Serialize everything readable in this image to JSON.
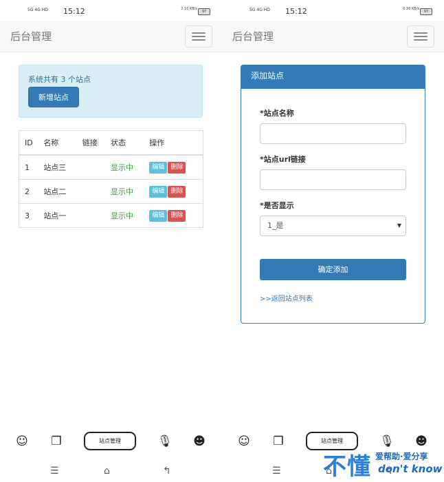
{
  "status_bar": {
    "signal_text": "5G 4G HD",
    "time": "15:12",
    "left_speed": "2.10 KB/s",
    "right_speed": "0.30 KB/s",
    "battery": "97"
  },
  "nav": {
    "brand": "后台管理"
  },
  "list_page": {
    "summary": "系统共有 3 个站点",
    "new_button": "新增站点",
    "table": {
      "headers": [
        "ID",
        "名称",
        "链接",
        "状态",
        "操作"
      ],
      "rows": [
        {
          "id": "1",
          "name": "站点三",
          "link": "",
          "status": "显示中"
        },
        {
          "id": "2",
          "name": "站点二",
          "link": "",
          "status": "显示中"
        },
        {
          "id": "3",
          "name": "站点一",
          "link": "",
          "status": "显示中"
        }
      ],
      "edit_label": "编辑",
      "delete_label": "删除"
    }
  },
  "add_page": {
    "heading": "添加站点",
    "name_label": "*站点名称",
    "name_value": "",
    "url_label": "*站点url链接",
    "url_value": "",
    "show_label": "*是否显示",
    "show_selected": "1_是",
    "submit_label": "确定添加",
    "back_link": ">>返回站点列表"
  },
  "dock": {
    "pill_label": "站点管理"
  },
  "watermark": {
    "main": "不懂",
    "sub1": "爱帮助·爱分享",
    "sub2": "don't know"
  },
  "colors": {
    "primary": "#337ab7",
    "info_bg": "#d9edf7",
    "info_text": "#31708f",
    "success": "#3c9d3c",
    "edit": "#5bc0de",
    "danger": "#d9534f"
  }
}
